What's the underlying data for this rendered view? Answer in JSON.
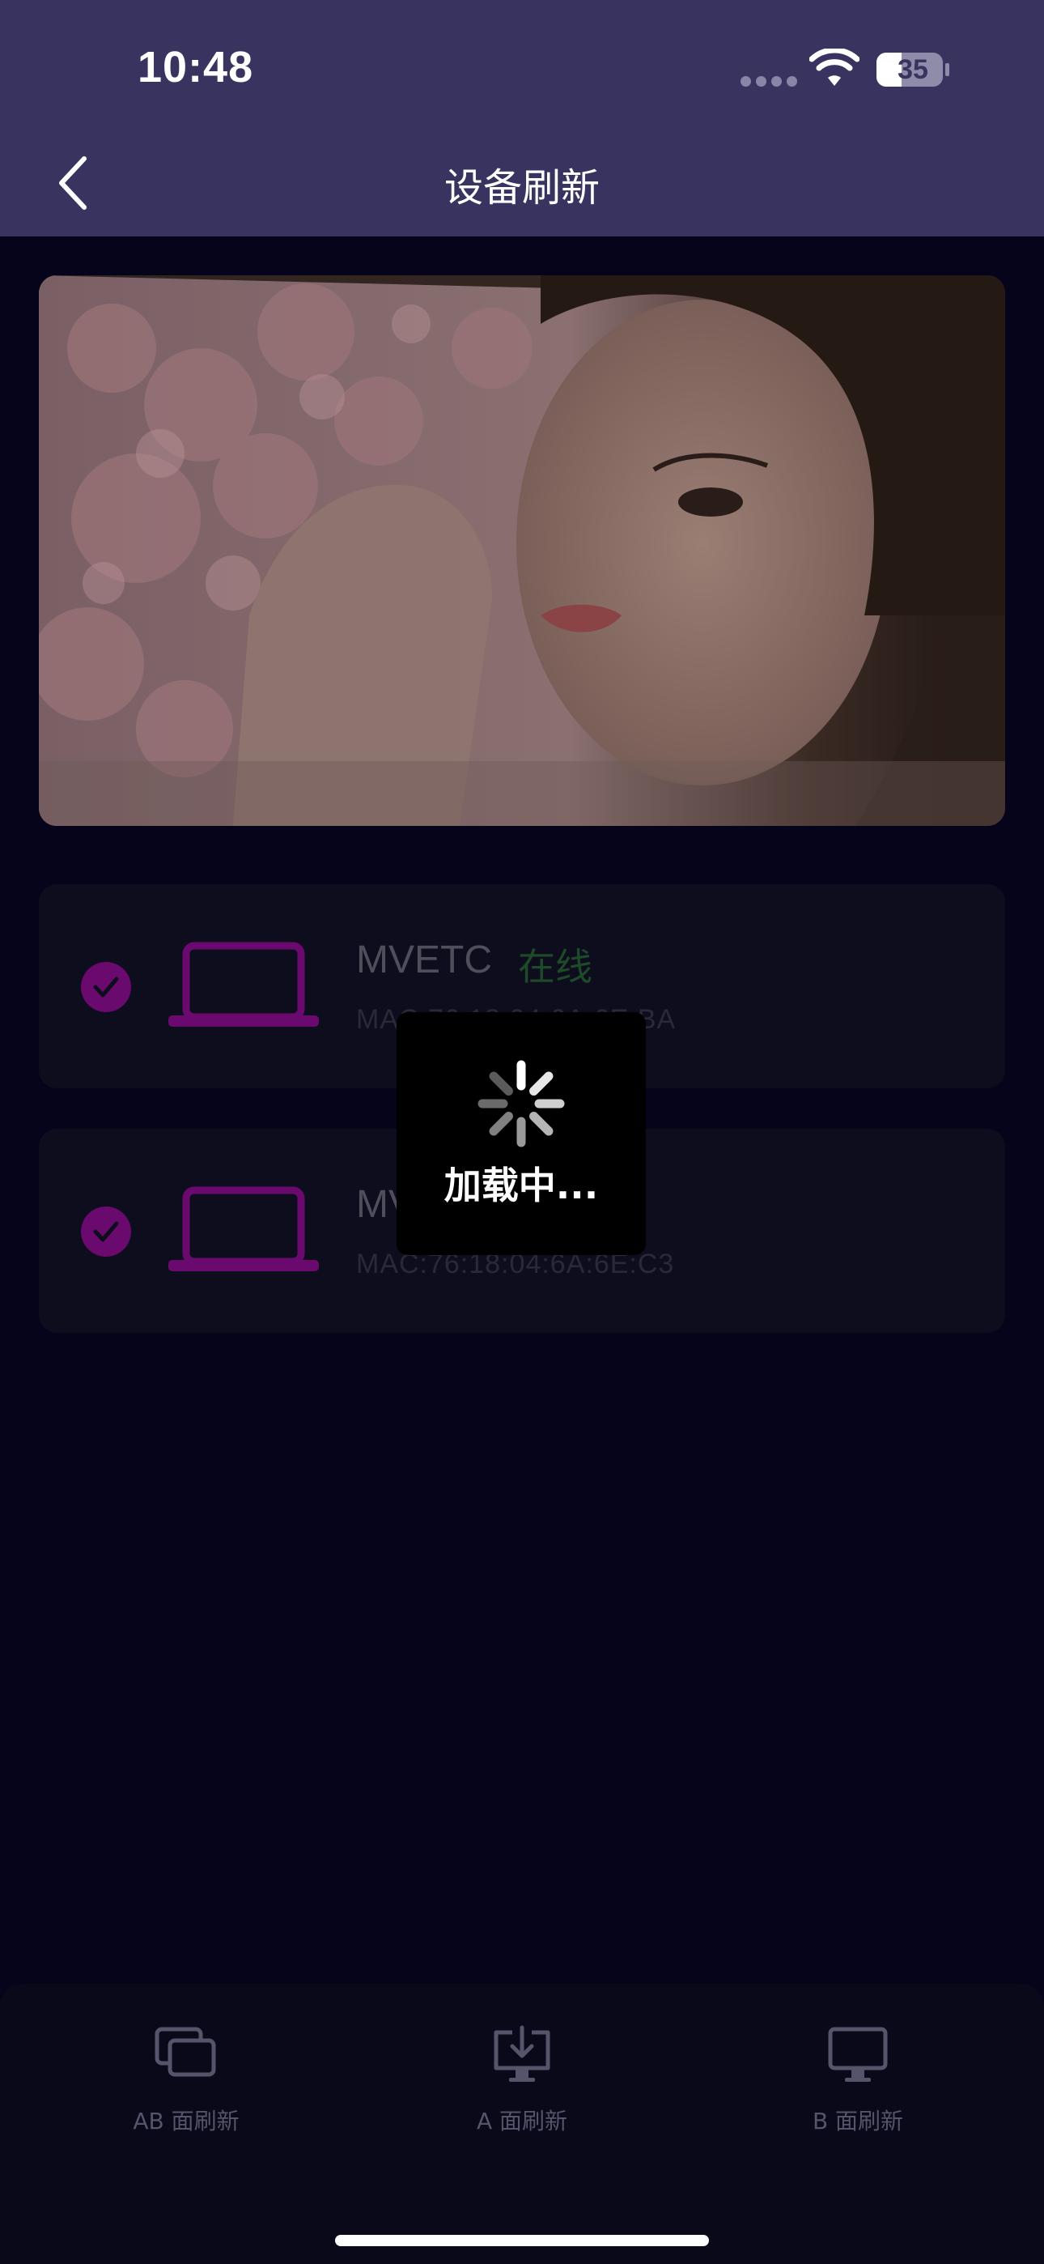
{
  "status_bar": {
    "time": "10:48",
    "battery": "35"
  },
  "nav": {
    "title": "设备刷新"
  },
  "devices": [
    {
      "name": "MVETC",
      "status": "在线",
      "mac": "MAC:76:18:04:6A:6E:BA"
    },
    {
      "name": "MVETC",
      "status": "",
      "mac": "MAC:76:18:04:6A:6E:C3"
    }
  ],
  "loading": {
    "text": "加载中..."
  },
  "tabs": [
    {
      "label": "AB 面刷新",
      "icon": "ab-refresh-icon"
    },
    {
      "label": "A 面刷新",
      "icon": "download-screen-icon"
    },
    {
      "label": "B 面刷新",
      "icon": "monitor-icon"
    }
  ],
  "colors": {
    "header": "#38345f",
    "background": "#05041a",
    "accent": "#6a0a6e",
    "online": "#1d4a28"
  }
}
